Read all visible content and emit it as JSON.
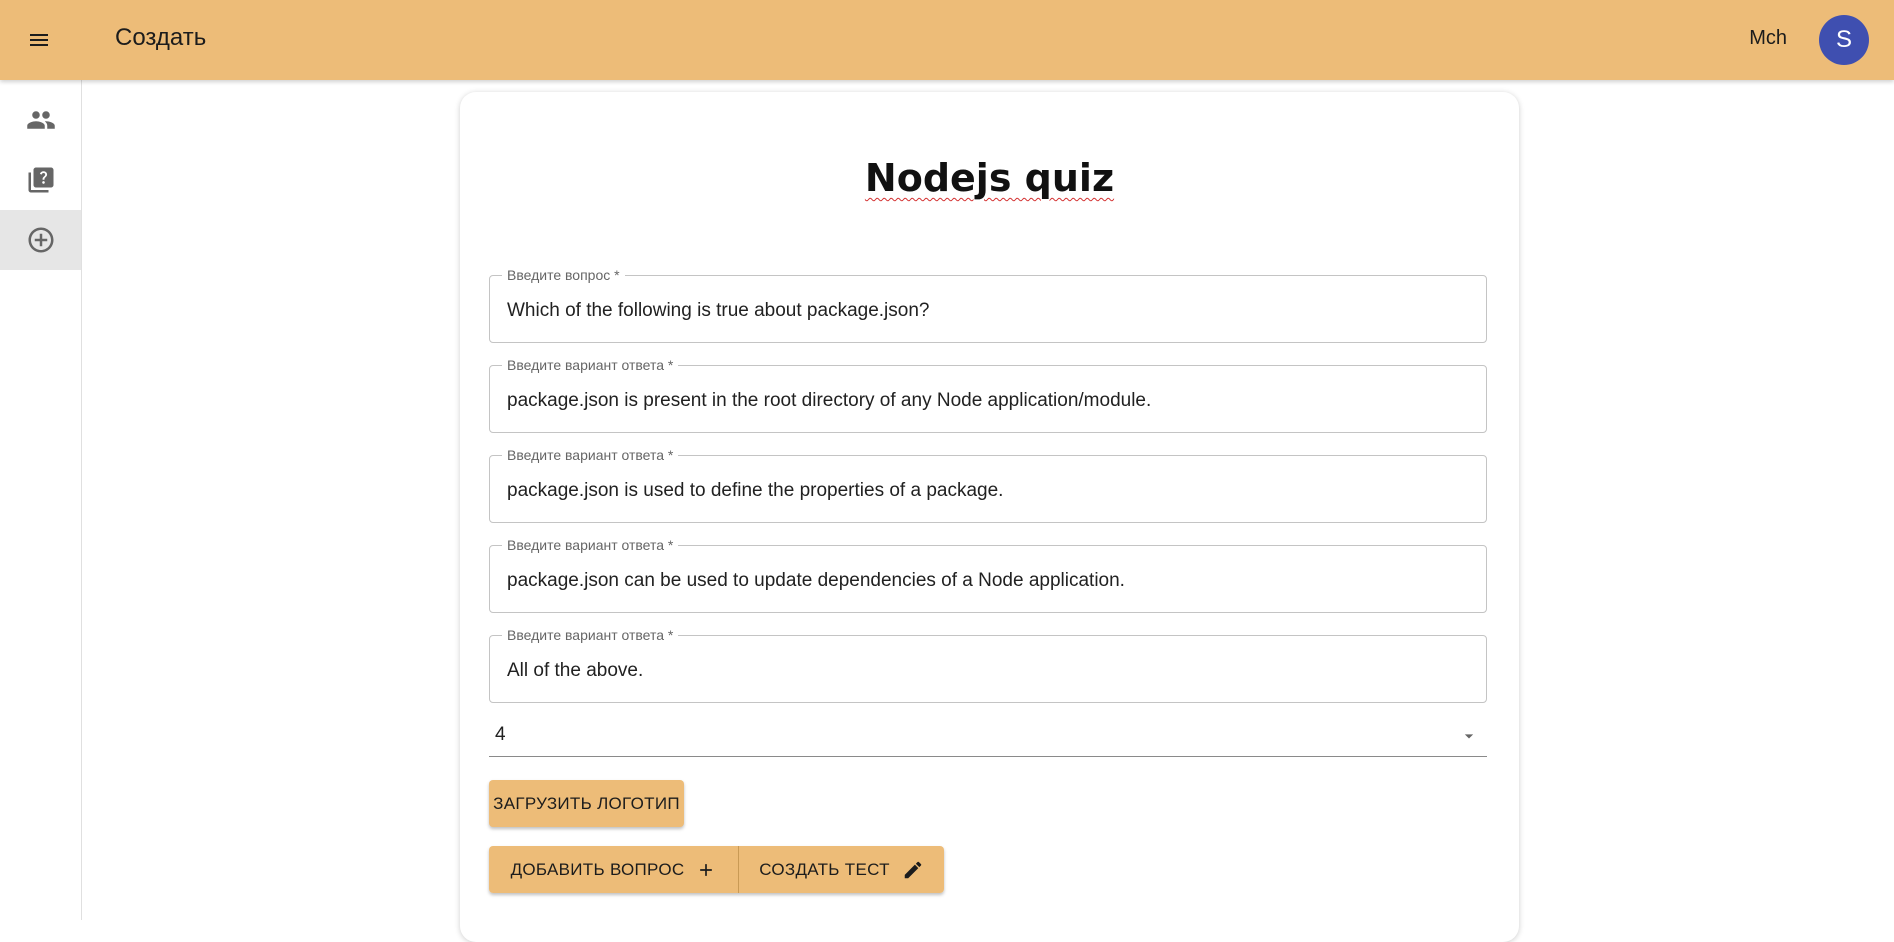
{
  "appbar": {
    "title": "Создать",
    "user_name": "Mch",
    "avatar_initial": "S",
    "color": "#edbc78",
    "avatar_color": "#3f4fb0"
  },
  "sidebar": {
    "items": [
      {
        "icon": "people-icon",
        "active": false
      },
      {
        "icon": "quiz-library-icon",
        "active": false
      },
      {
        "icon": "add-circle-icon",
        "active": true
      }
    ]
  },
  "form": {
    "quiz_title": "Nodejs quiz",
    "question": {
      "label": "Введите вопрос *",
      "value": "Which of the following is true about package.json?"
    },
    "answers": [
      {
        "label": "Введите вариант ответа *",
        "value": "package.json is present in the root directory of any Node application/module."
      },
      {
        "label": "Введите вариант ответа *",
        "value": "package.json is used to define the properties of a package."
      },
      {
        "label": "Введите вариант ответа *",
        "value": "package.json can be used to update dependencies of a Node application."
      },
      {
        "label": "Введите вариант ответа *",
        "value": "All of the above."
      }
    ],
    "correct_answer_select": {
      "value": "4"
    },
    "upload_logo_label": "ЗАГРУЗИТЬ ЛОГОТИП",
    "add_question_label": "ДОБАВИТЬ ВОПРОС",
    "create_test_label": "СОЗДАТЬ ТЕСТ"
  }
}
